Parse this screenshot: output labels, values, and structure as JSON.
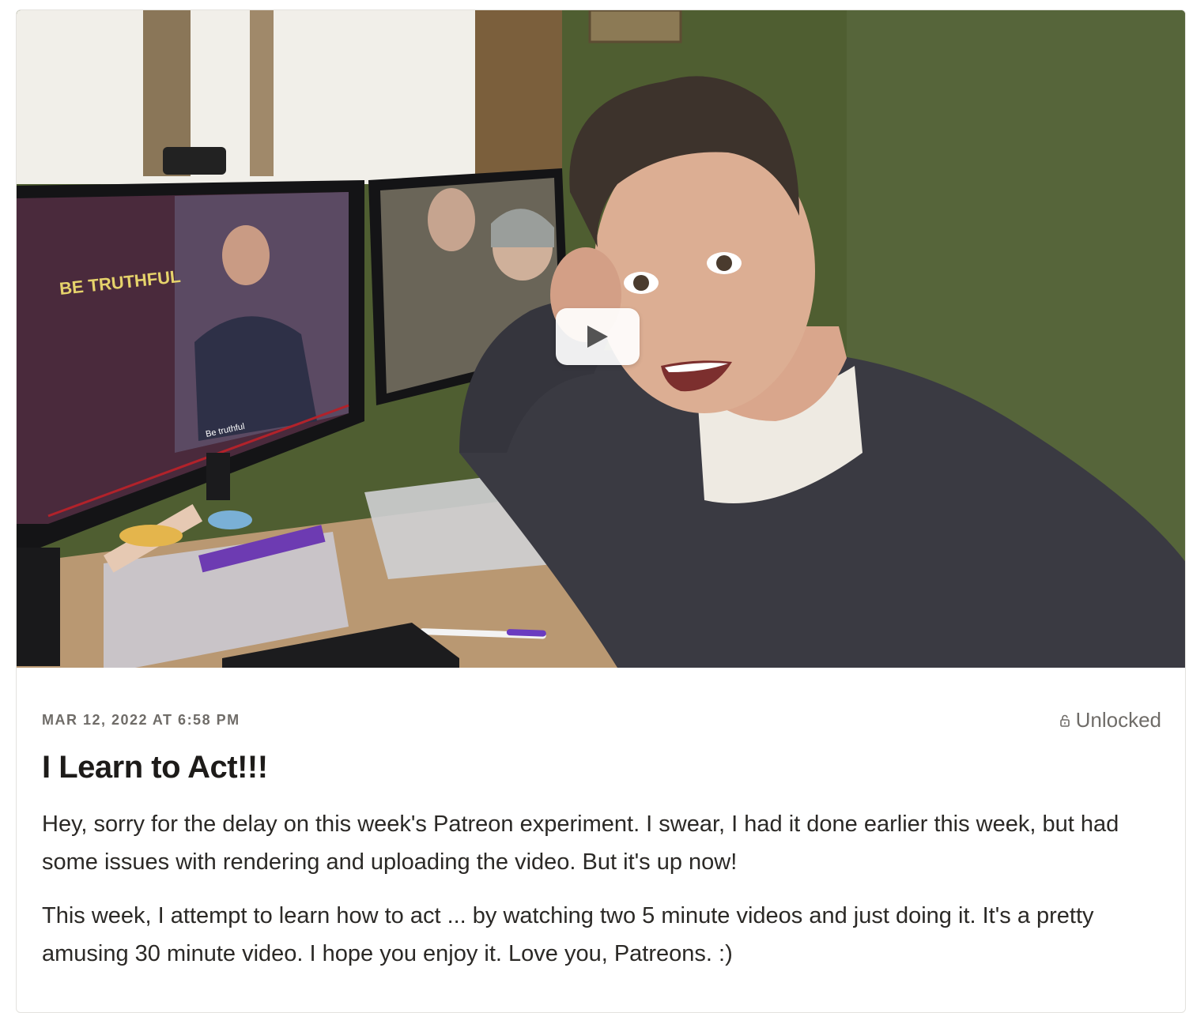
{
  "post": {
    "date": "MAR 12, 2022 AT 6:58 PM",
    "status_label": "Unlocked",
    "status_icon": "unlocked-padlock-icon",
    "title": "I Learn to Act!!!",
    "paragraphs": [
      "Hey, sorry for the delay on this week's Patreon experiment. I swear, I had it done earlier this week, but had some issues with rendering and uploading the video. But it's up now!",
      "This week, I attempt to learn how to act ... by watching two 5 minute videos and just doing it. It's a pretty amusing 30 minute video. I hope you enjoy it. Love you, Patreons. :)"
    ]
  },
  "video": {
    "play_icon": "play-icon",
    "screen_caption": "BE TRUTHFUL",
    "screen_subtitle": "Be truthful"
  },
  "colors": {
    "wall": "#4b5a2f",
    "sweater": "#3a3a42",
    "text": "#2b2926",
    "muted": "#6f6c68"
  }
}
